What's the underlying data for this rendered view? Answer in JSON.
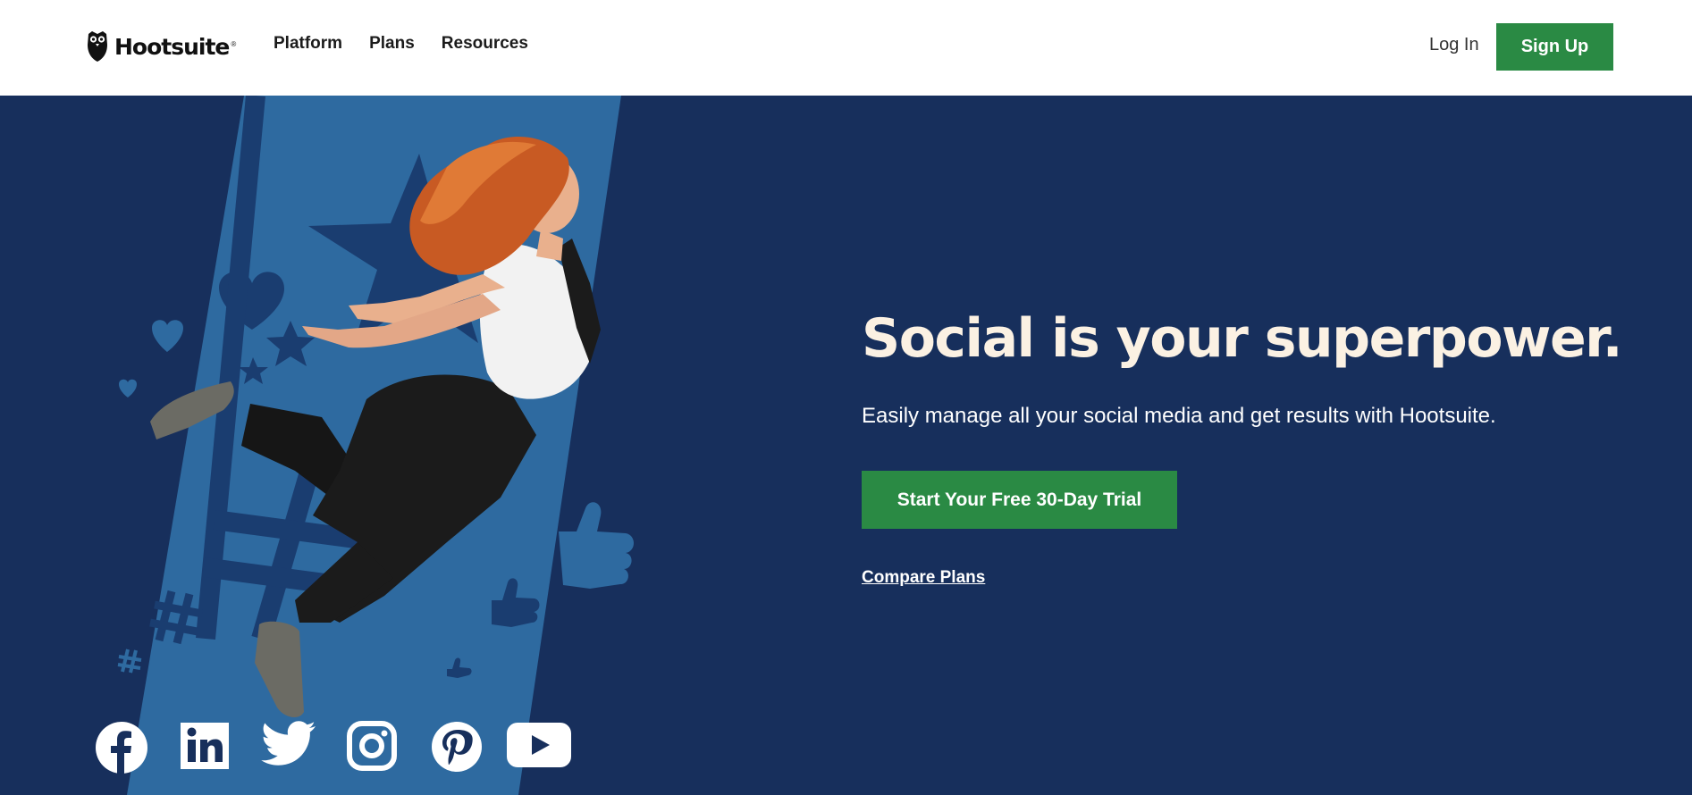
{
  "header": {
    "brand": "Hootsuite",
    "brand_mark": "®",
    "nav": [
      {
        "label": "Platform"
      },
      {
        "label": "Plans"
      },
      {
        "label": "Resources"
      }
    ],
    "login_label": "Log In",
    "signup_label": "Sign Up"
  },
  "hero": {
    "headline": "Social is your superpower.",
    "subheadline": "Easily manage all your social media and get results with Hootsuite.",
    "cta_label": "Start Your Free 30-Day Trial",
    "compare_label": "Compare Plans",
    "illustration": "woman-jumping-with-social-icons",
    "social_icons": [
      "facebook-icon",
      "linkedin-icon",
      "twitter-icon",
      "instagram-icon",
      "pinterest-icon",
      "youtube-icon"
    ]
  },
  "colors": {
    "hero_background": "#172f5c",
    "stripe": "#2e6aa0",
    "accent_green": "#2a8a44",
    "headline": "#fbf1e3"
  }
}
